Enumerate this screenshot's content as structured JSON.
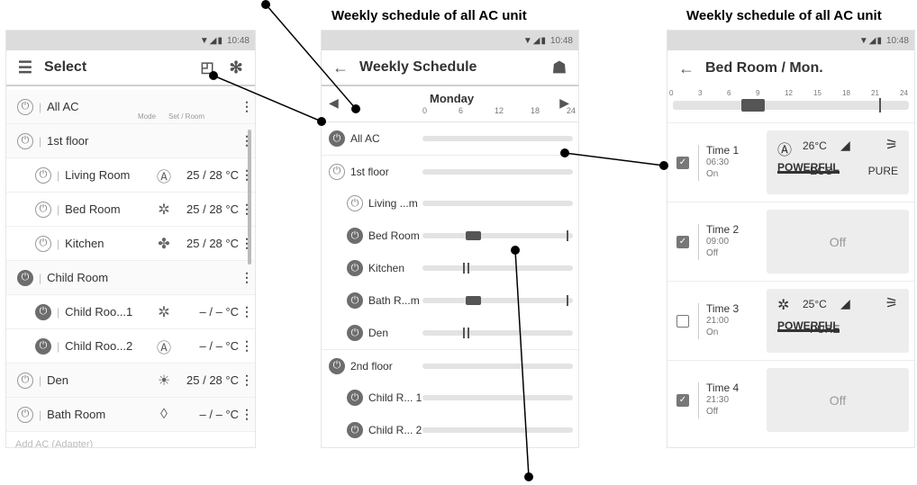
{
  "captions": {
    "center": "Weekly schedule of all AC unit",
    "right": "Weekly schedule of all AC unit"
  },
  "status": {
    "time": "10:48"
  },
  "select_screen": {
    "title": "Select",
    "col_mode": "Mode",
    "col_set": "Set / Room",
    "rows": [
      {
        "name": "All AC",
        "mode": "",
        "temp": "",
        "on": false,
        "indent": 0
      },
      {
        "name": "1st floor",
        "mode": "",
        "temp": "",
        "on": false,
        "indent": 0
      },
      {
        "name": "Living Room",
        "mode": "Ⓐ",
        "temp": "25 / 28 °C",
        "on": false,
        "indent": 1
      },
      {
        "name": "Bed Room",
        "mode": "✲",
        "temp": "25 / 28 °C",
        "on": false,
        "indent": 1
      },
      {
        "name": "Kitchen",
        "mode": "✤",
        "temp": "25 / 28 °C",
        "on": false,
        "indent": 1
      },
      {
        "name": "Child Room",
        "mode": "",
        "temp": "",
        "on": true,
        "indent": 0
      },
      {
        "name": "Child Roo...1",
        "mode": "✲",
        "temp": "– / –  °C",
        "on": true,
        "indent": 1
      },
      {
        "name": "Child Roo...2",
        "mode": "Ⓐ",
        "temp": "– / –  °C",
        "on": true,
        "indent": 1
      },
      {
        "name": "Den",
        "mode": "☀",
        "temp": "25 / 28 °C",
        "on": false,
        "indent": 0
      },
      {
        "name": "Bath Room",
        "mode": "◊",
        "temp": "– / –  °C",
        "on": false,
        "indent": 0
      }
    ],
    "add_link": "Add AC (Adapter)"
  },
  "weekly_screen": {
    "title": "Weekly Schedule",
    "day": "Monday",
    "ticks": [
      "0",
      "6",
      "12",
      "18",
      "24"
    ],
    "rows": [
      {
        "name": "All AC",
        "on": true,
        "indent": 0
      },
      {
        "name": "1st floor",
        "on": false,
        "indent": 0
      },
      {
        "name": "Living ...m",
        "on": false,
        "indent": 1
      },
      {
        "name": "Bed Room",
        "on": true,
        "indent": 1
      },
      {
        "name": "Kitchen",
        "on": true,
        "indent": 1
      },
      {
        "name": "Bath R...m",
        "on": true,
        "indent": 1
      },
      {
        "name": "Den",
        "on": true,
        "indent": 1
      },
      {
        "name": "2nd floor",
        "on": true,
        "indent": 0
      },
      {
        "name": "Child R... 1",
        "on": true,
        "indent": 1
      },
      {
        "name": "Child R... 2",
        "on": true,
        "indent": 1
      }
    ]
  },
  "detail_screen": {
    "title": "Bed Room / Mon.",
    "ticks": [
      "0",
      "3",
      "6",
      "9",
      "12",
      "15",
      "18",
      "21",
      "24"
    ],
    "times": [
      {
        "label": "Time 1",
        "time": "06:30",
        "state": "On",
        "checked": true,
        "temp": "26°C",
        "mode_icon": "Ⓐ",
        "func1": "ECO",
        "func2": "PURE",
        "off": false
      },
      {
        "label": "Time 2",
        "time": "09:00",
        "state": "Off",
        "checked": true,
        "off": true,
        "off_text": "Off"
      },
      {
        "label": "Time 3",
        "time": "21:00",
        "state": "On",
        "checked": false,
        "temp": "25°C",
        "mode_icon": "✲",
        "func1": "PURE",
        "func2": "",
        "off": false
      },
      {
        "label": "Time 4",
        "time": "21:30",
        "state": "Off",
        "checked": true,
        "off": true,
        "off_text": "Off"
      }
    ]
  }
}
